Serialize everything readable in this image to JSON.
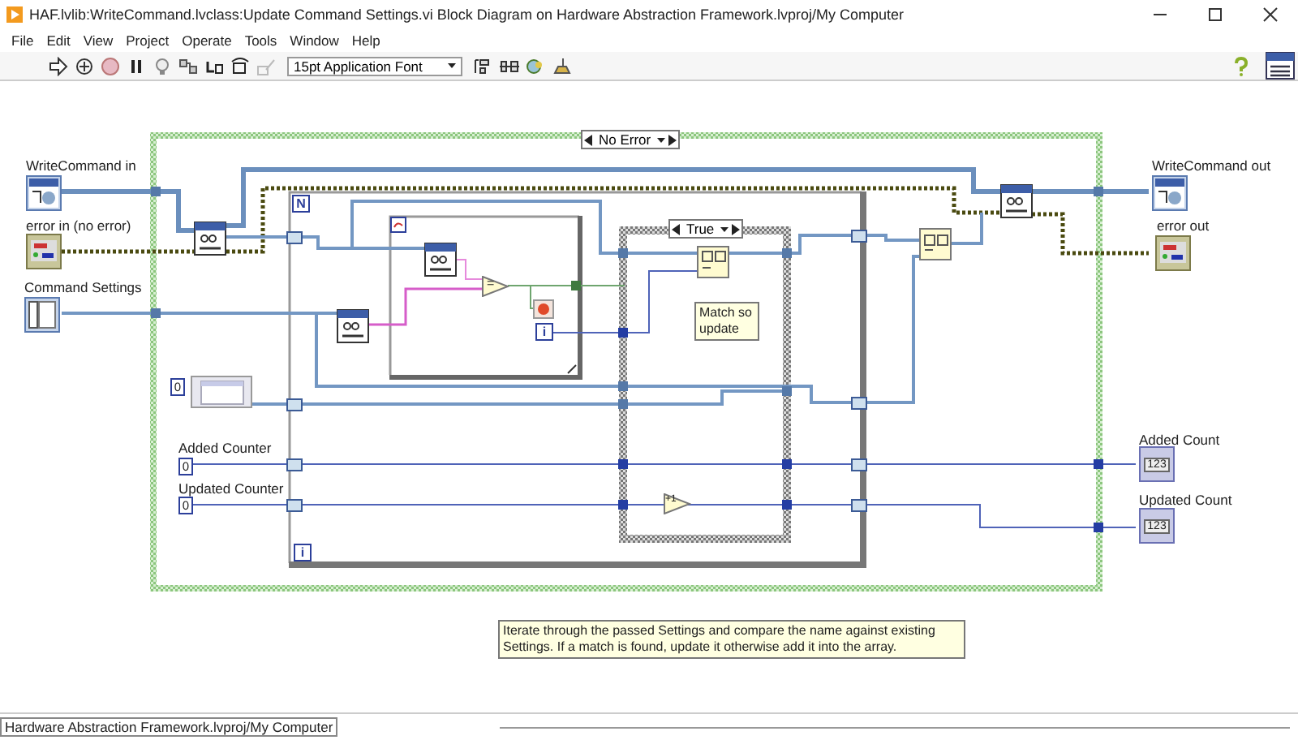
{
  "window": {
    "title": "HAF.lvlib:WriteCommand.lvclass:Update Command Settings.vi Block Diagram on Hardware Abstraction Framework.lvproj/My Computer"
  },
  "menu": [
    "File",
    "Edit",
    "View",
    "Project",
    "Operate",
    "Tools",
    "Window",
    "Help"
  ],
  "toolbar": {
    "font": "15pt Application Font"
  },
  "diagram": {
    "case_selector": "No Error",
    "inner_case_selector": "True",
    "for_loop": {
      "count": "N",
      "index": "i"
    },
    "while_loop": {
      "index": "i"
    },
    "equal": "=",
    "increment": "+1",
    "controls": [
      {
        "label": "WriteCommand in",
        "kind": "class"
      },
      {
        "label": "error in (no error)",
        "kind": "error"
      },
      {
        "label": "Command Settings",
        "kind": "array"
      }
    ],
    "array_constant": {
      "index": "0"
    },
    "constants": [
      {
        "label": "Added Counter",
        "value": "0"
      },
      {
        "label": "Updated Counter",
        "value": "0"
      }
    ],
    "indicators": [
      {
        "label": "WriteCommand out",
        "kind": "class"
      },
      {
        "label": "error out",
        "kind": "error"
      },
      {
        "label": "Added Count",
        "kind": "numeric",
        "display": "123"
      },
      {
        "label": "Updated Count",
        "kind": "numeric",
        "display": "123"
      }
    ],
    "comments": [
      {
        "text": "Match so update"
      },
      {
        "text": "Iterate through the passed Settings and compare the name against existing Settings. If a match is found, update it otherwise add it into the array."
      }
    ]
  },
  "status_bar": "Hardware Abstraction Framework.lvproj/My Computer"
}
